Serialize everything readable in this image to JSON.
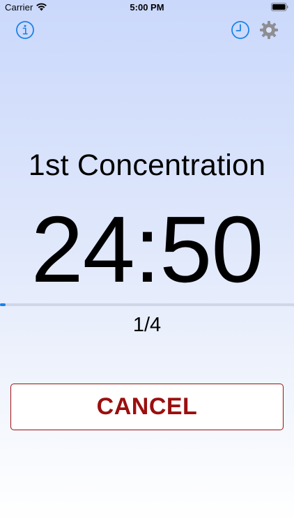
{
  "status_bar": {
    "carrier": "Carrier",
    "time": "5:00 PM"
  },
  "toolbar": {
    "info_icon": "info-icon",
    "history_icon": "clock-icon",
    "settings_icon": "gear-icon"
  },
  "main": {
    "phase_title": "1st Concentration",
    "timer": "24:50",
    "progress": 0.02,
    "round_counter": "1/4"
  },
  "actions": {
    "cancel_label": "CANCEL"
  },
  "colors": {
    "accent": "#1a82e8",
    "cancel": "#9b0f0f",
    "icon_gray": "#8e8e93"
  }
}
